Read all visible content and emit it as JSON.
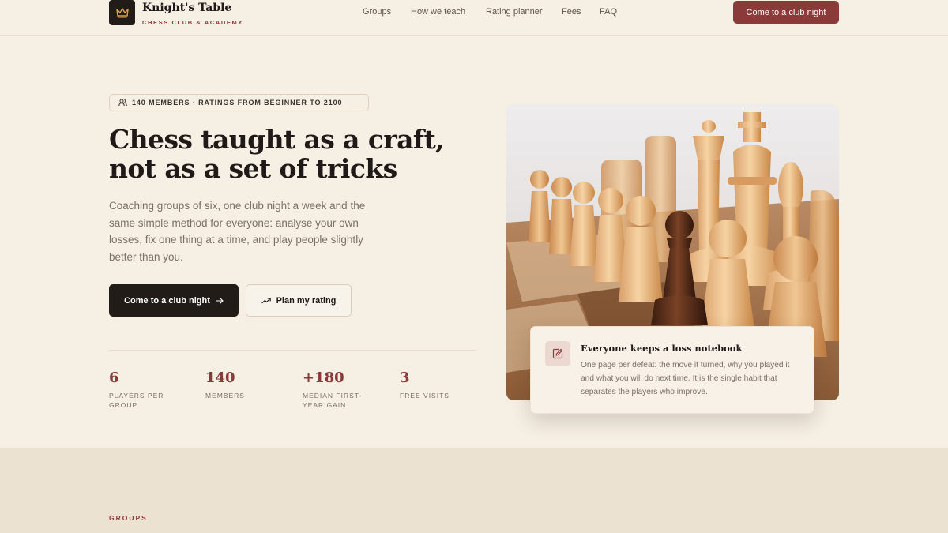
{
  "brand": {
    "name": "Knight's Table",
    "tagline": "CHESS CLUB & ACADEMY",
    "logo_icon": "crown-icon"
  },
  "nav": {
    "items": [
      "Groups",
      "How we teach",
      "Rating planner",
      "Fees",
      "FAQ"
    ],
    "cta_label": "Come to a club night"
  },
  "hero": {
    "pill_text": "140 MEMBERS · RATINGS FROM BEGINNER TO 2100",
    "pill_icon": "users-icon",
    "title": "Chess taught as a craft, not as a set of tricks",
    "subtitle": "Coaching groups of six, one club night a week and the same simple method for everyone: analyse your own losses, fix one thing at a time, and play people slightly better than you.",
    "primary_label": "Come to a club night",
    "secondary_label": "Plan my rating",
    "stats": [
      {
        "value": "6",
        "label": "PLAYERS PER GROUP"
      },
      {
        "value": "140",
        "label": "MEMBERS"
      },
      {
        "value": "+180",
        "label": "MEDIAN FIRST-YEAR GAIN"
      },
      {
        "value": "3",
        "label": "FREE VISITS"
      }
    ]
  },
  "note_card": {
    "icon": "edit-note-icon",
    "title": "Everyone keeps a loss notebook",
    "body": "One page per defeat: the move it turned, why you played it and what you will do next time. It is the single habit that separates the players who improve."
  },
  "groups_section": {
    "label": "GROUPS"
  },
  "colors": {
    "background": "#f5efe4",
    "accent": "#8b3a3a",
    "dark": "#221c18",
    "band": "#ebe2d1"
  }
}
